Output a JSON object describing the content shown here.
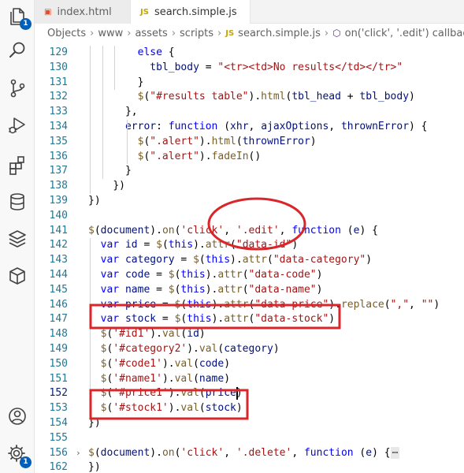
{
  "activity_bar": {
    "items": [
      {
        "name": "explorer-icon",
        "badge": "1"
      },
      {
        "name": "search-icon"
      },
      {
        "name": "source-control-icon"
      },
      {
        "name": "run-debug-icon"
      },
      {
        "name": "extensions-icon"
      },
      {
        "name": "database-icon"
      },
      {
        "name": "layers-icon"
      },
      {
        "name": "package-icon"
      }
    ],
    "bottom": [
      {
        "name": "account-icon"
      },
      {
        "name": "settings-gear-icon",
        "badge": "1"
      }
    ]
  },
  "tabs": [
    {
      "label": "index.html",
      "icon": "html5-icon",
      "active": false
    },
    {
      "label": "search.simple.js",
      "icon": "js-icon",
      "active": true,
      "dirty": true
    }
  ],
  "breadcrumb": [
    "Objects",
    "www",
    "assets",
    "scripts",
    "search.simple.js",
    "on('click', '.edit') callback"
  ],
  "editor": {
    "current_line": 152,
    "lines": [
      {
        "n": "129",
        "indent": 4,
        "tokens": [
          [
            "kw",
            "else"
          ],
          [
            "",
            " {"
          ]
        ]
      },
      {
        "n": "130",
        "indent": 5,
        "tokens": [
          [
            "var",
            "tbl_body"
          ],
          [
            "",
            " = "
          ],
          [
            "str",
            "\"<tr><td>No results</td></tr>\""
          ]
        ]
      },
      {
        "n": "131",
        "indent": 4,
        "tokens": [
          [
            "",
            "}"
          ]
        ]
      },
      {
        "n": "132",
        "indent": 4,
        "tokens": [
          [
            "fn",
            "$"
          ],
          [
            "",
            "("
          ],
          [
            "str",
            "\"#results table\""
          ],
          [
            "",
            ")."
          ],
          [
            "fn",
            "html"
          ],
          [
            "",
            "("
          ],
          [
            "var",
            "tbl_head"
          ],
          [
            "",
            " + "
          ],
          [
            "var",
            "tbl_body"
          ],
          [
            "",
            ")"
          ]
        ]
      },
      {
        "n": "133",
        "indent": 3,
        "tokens": [
          [
            "",
            "},"
          ]
        ]
      },
      {
        "n": "134",
        "indent": 3,
        "tokens": [
          [
            "var",
            "error"
          ],
          [
            "",
            ": "
          ],
          [
            "kw",
            "function"
          ],
          [
            "",
            " ("
          ],
          [
            "prm",
            "xhr"
          ],
          [
            "",
            ", "
          ],
          [
            "prm",
            "ajaxOptions"
          ],
          [
            "",
            ", "
          ],
          [
            "prm",
            "thrownError"
          ],
          [
            "",
            ") {"
          ]
        ]
      },
      {
        "n": "135",
        "indent": 4,
        "tokens": [
          [
            "fn",
            "$"
          ],
          [
            "",
            "("
          ],
          [
            "str",
            "\".alert\""
          ],
          [
            "",
            ")."
          ],
          [
            "fn",
            "html"
          ],
          [
            "",
            "("
          ],
          [
            "prm",
            "thrownError"
          ],
          [
            "",
            ")"
          ]
        ]
      },
      {
        "n": "136",
        "indent": 4,
        "tokens": [
          [
            "fn",
            "$"
          ],
          [
            "",
            "("
          ],
          [
            "str",
            "\".alert\""
          ],
          [
            "",
            ")."
          ],
          [
            "fn",
            "fadeIn"
          ],
          [
            "",
            "()"
          ]
        ]
      },
      {
        "n": "137",
        "indent": 3,
        "tokens": [
          [
            "",
            "}"
          ]
        ]
      },
      {
        "n": "138",
        "indent": 2,
        "tokens": [
          [
            "",
            "})"
          ]
        ]
      },
      {
        "n": "139",
        "indent": 0,
        "tokens": [
          [
            "",
            "})"
          ]
        ]
      },
      {
        "n": "140",
        "indent": 0,
        "tokens": []
      },
      {
        "n": "141",
        "indent": 0,
        "tokens": [
          [
            "fn",
            "$"
          ],
          [
            "",
            "("
          ],
          [
            "var",
            "document"
          ],
          [
            "",
            ")."
          ],
          [
            "fn",
            "on"
          ],
          [
            "",
            "("
          ],
          [
            "str",
            "'click'"
          ],
          [
            "",
            ", "
          ],
          [
            "str",
            "'.edit'"
          ],
          [
            "",
            ", "
          ],
          [
            "kw",
            "function"
          ],
          [
            "",
            " ("
          ],
          [
            "prm",
            "e"
          ],
          [
            "",
            ") {"
          ]
        ]
      },
      {
        "n": "142",
        "indent": 1,
        "tokens": [
          [
            "kw",
            "var"
          ],
          [
            "",
            " "
          ],
          [
            "var",
            "id"
          ],
          [
            "",
            " = "
          ],
          [
            "fn",
            "$"
          ],
          [
            "",
            "("
          ],
          [
            "kw",
            "this"
          ],
          [
            "",
            ")."
          ],
          [
            "fn",
            "attr"
          ],
          [
            "",
            "("
          ],
          [
            "str",
            "\"data-id\""
          ],
          [
            "",
            ")"
          ]
        ]
      },
      {
        "n": "143",
        "indent": 1,
        "tokens": [
          [
            "kw",
            "var"
          ],
          [
            "",
            " "
          ],
          [
            "var",
            "category"
          ],
          [
            "",
            " = "
          ],
          [
            "fn",
            "$"
          ],
          [
            "",
            "("
          ],
          [
            "kw",
            "this"
          ],
          [
            "",
            ")."
          ],
          [
            "fn",
            "attr"
          ],
          [
            "",
            "("
          ],
          [
            "str",
            "\"data-category\""
          ],
          [
            "",
            ")"
          ]
        ]
      },
      {
        "n": "144",
        "indent": 1,
        "tokens": [
          [
            "kw",
            "var"
          ],
          [
            "",
            " "
          ],
          [
            "var",
            "code"
          ],
          [
            "",
            " = "
          ],
          [
            "fn",
            "$"
          ],
          [
            "",
            "("
          ],
          [
            "kw",
            "this"
          ],
          [
            "",
            ")."
          ],
          [
            "fn",
            "attr"
          ],
          [
            "",
            "("
          ],
          [
            "str",
            "\"data-code\""
          ],
          [
            "",
            ")"
          ]
        ]
      },
      {
        "n": "145",
        "indent": 1,
        "tokens": [
          [
            "kw",
            "var"
          ],
          [
            "",
            " "
          ],
          [
            "var",
            "name"
          ],
          [
            "",
            " = "
          ],
          [
            "fn",
            "$"
          ],
          [
            "",
            "("
          ],
          [
            "kw",
            "this"
          ],
          [
            "",
            ")."
          ],
          [
            "fn",
            "attr"
          ],
          [
            "",
            "("
          ],
          [
            "str",
            "\"data-name\""
          ],
          [
            "",
            ")"
          ]
        ]
      },
      {
        "n": "146",
        "indent": 1,
        "tokens": [
          [
            "kw",
            "var"
          ],
          [
            "",
            " "
          ],
          [
            "var",
            "price"
          ],
          [
            "",
            " = "
          ],
          [
            "fn",
            "$"
          ],
          [
            "",
            "("
          ],
          [
            "kw",
            "this"
          ],
          [
            "",
            ")."
          ],
          [
            "fn",
            "attr"
          ],
          [
            "",
            "("
          ],
          [
            "str",
            "\"data-price\""
          ],
          [
            "",
            ")."
          ],
          [
            "fn",
            "replace"
          ],
          [
            "",
            "("
          ],
          [
            "str",
            "\",\""
          ],
          [
            "",
            ", "
          ],
          [
            "str",
            "\"\""
          ],
          [
            "",
            ")"
          ]
        ]
      },
      {
        "n": "147",
        "indent": 1,
        "tokens": [
          [
            "kw",
            "var"
          ],
          [
            "",
            " "
          ],
          [
            "var",
            "stock"
          ],
          [
            "",
            " = "
          ],
          [
            "fn",
            "$"
          ],
          [
            "",
            "("
          ],
          [
            "kw",
            "this"
          ],
          [
            "",
            ")."
          ],
          [
            "fn",
            "attr"
          ],
          [
            "",
            "("
          ],
          [
            "str",
            "\"data-stock\""
          ],
          [
            "",
            ")"
          ]
        ]
      },
      {
        "n": "148",
        "indent": 1,
        "tokens": [
          [
            "fn",
            "$"
          ],
          [
            "",
            "("
          ],
          [
            "str",
            "'#id1'"
          ],
          [
            "",
            ")."
          ],
          [
            "fn",
            "val"
          ],
          [
            "",
            "("
          ],
          [
            "var",
            "id"
          ],
          [
            "",
            ")"
          ]
        ]
      },
      {
        "n": "149",
        "indent": 1,
        "tokens": [
          [
            "fn",
            "$"
          ],
          [
            "",
            "("
          ],
          [
            "str",
            "'#category2'"
          ],
          [
            "",
            ")."
          ],
          [
            "fn",
            "val"
          ],
          [
            "",
            "("
          ],
          [
            "var",
            "category"
          ],
          [
            "",
            ")"
          ]
        ]
      },
      {
        "n": "150",
        "indent": 1,
        "tokens": [
          [
            "fn",
            "$"
          ],
          [
            "",
            "("
          ],
          [
            "str",
            "'#code1'"
          ],
          [
            "",
            ")."
          ],
          [
            "fn",
            "val"
          ],
          [
            "",
            "("
          ],
          [
            "var",
            "code"
          ],
          [
            "",
            ")"
          ]
        ]
      },
      {
        "n": "151",
        "indent": 1,
        "tokens": [
          [
            "fn",
            "$"
          ],
          [
            "",
            "("
          ],
          [
            "str",
            "'#name1'"
          ],
          [
            "",
            ")."
          ],
          [
            "fn",
            "val"
          ],
          [
            "",
            "("
          ],
          [
            "var",
            "name"
          ],
          [
            "",
            ")"
          ]
        ]
      },
      {
        "n": "152",
        "indent": 1,
        "tokens": [
          [
            "fn",
            "$"
          ],
          [
            "",
            "("
          ],
          [
            "str",
            "'#price1'"
          ],
          [
            "",
            ")."
          ],
          [
            "fn",
            "val"
          ],
          [
            "",
            "("
          ],
          [
            "var",
            "price"
          ],
          [
            "",
            ")"
          ]
        ]
      },
      {
        "n": "153",
        "indent": 1,
        "tokens": [
          [
            "fn",
            "$"
          ],
          [
            "",
            "("
          ],
          [
            "str",
            "'#stock1'"
          ],
          [
            "",
            ")."
          ],
          [
            "fn",
            "val"
          ],
          [
            "",
            "("
          ],
          [
            "var",
            "stock"
          ],
          [
            "",
            ")"
          ]
        ]
      },
      {
        "n": "154",
        "indent": 0,
        "tokens": [
          [
            "",
            "})"
          ]
        ]
      },
      {
        "n": "155",
        "indent": 0,
        "tokens": []
      },
      {
        "n": "156",
        "indent": 0,
        "folded": true,
        "tokens": [
          [
            "fn",
            "$"
          ],
          [
            "",
            "("
          ],
          [
            "var",
            "document"
          ],
          [
            "",
            ")."
          ],
          [
            "fn",
            "on"
          ],
          [
            "",
            "("
          ],
          [
            "str",
            "'click'"
          ],
          [
            "",
            ", "
          ],
          [
            "str",
            "'.delete'"
          ],
          [
            "",
            ", "
          ],
          [
            "kw",
            "function"
          ],
          [
            "",
            " ("
          ],
          [
            "prm",
            "e"
          ],
          [
            "",
            ") {"
          ],
          [
            "ell",
            "⋯"
          ]
        ]
      },
      {
        "n": "162",
        "indent": 0,
        "tokens": [
          [
            "",
            "})"
          ]
        ]
      }
    ]
  }
}
